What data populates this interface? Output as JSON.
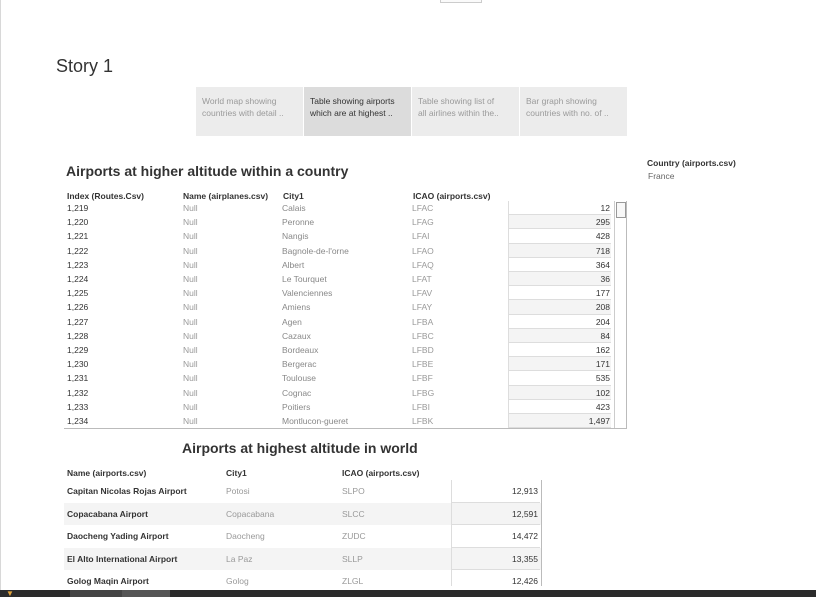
{
  "story": {
    "title": "Story 1"
  },
  "story_points": [
    {
      "line1": "World map showing",
      "line2": "countries with detail ..",
      "active": false
    },
    {
      "line1": "Table showing airports",
      "line2": "which are at highest ..",
      "active": true
    },
    {
      "line1": "Table showing list of",
      "line2": "all airlines within the..",
      "active": false
    },
    {
      "line1": "Bar graph showing",
      "line2": "countries with no. of ..",
      "active": false
    }
  ],
  "filter": {
    "label": "Country (airports.csv)",
    "value": "France"
  },
  "table1": {
    "title": "Airports at higher altitude within a country",
    "headers": [
      "Index (Routes.Csv)",
      "Name (airplanes.csv)",
      "City1",
      "ICAO (airports.csv)"
    ],
    "rows": [
      [
        "1,219",
        "Null",
        "Calais",
        "LFAC",
        "12"
      ],
      [
        "1,220",
        "Null",
        "Peronne",
        "LFAG",
        "295"
      ],
      [
        "1,221",
        "Null",
        "Nangis",
        "LFAI",
        "428"
      ],
      [
        "1,222",
        "Null",
        "Bagnole-de-l'orne",
        "LFAO",
        "718"
      ],
      [
        "1,223",
        "Null",
        "Albert",
        "LFAQ",
        "364"
      ],
      [
        "1,224",
        "Null",
        "Le Tourquet",
        "LFAT",
        "36"
      ],
      [
        "1,225",
        "Null",
        "Valenciennes",
        "LFAV",
        "177"
      ],
      [
        "1,226",
        "Null",
        "Amiens",
        "LFAY",
        "208"
      ],
      [
        "1,227",
        "Null",
        "Agen",
        "LFBA",
        "204"
      ],
      [
        "1,228",
        "Null",
        "Cazaux",
        "LFBC",
        "84"
      ],
      [
        "1,229",
        "Null",
        "Bordeaux",
        "LFBD",
        "162"
      ],
      [
        "1,230",
        "Null",
        "Bergerac",
        "LFBE",
        "171"
      ],
      [
        "1,231",
        "Null",
        "Toulouse",
        "LFBF",
        "535"
      ],
      [
        "1,232",
        "Null",
        "Cognac",
        "LFBG",
        "102"
      ],
      [
        "1,233",
        "Null",
        "Poitiers",
        "LFBI",
        "423"
      ],
      [
        "1,234",
        "Null",
        "Montlucon-gueret",
        "LFBK",
        "1,497"
      ]
    ]
  },
  "table2": {
    "title": "Airports at highest altitude in world",
    "headers": [
      "Name (airports.csv)",
      "City1",
      "ICAO (airports.csv)"
    ],
    "rows": [
      [
        "Capitan Nicolas Rojas Airport",
        "Potosi",
        "SLPO",
        "12,913"
      ],
      [
        "Copacabana Airport",
        "Copacabana",
        "SLCC",
        "12,591"
      ],
      [
        "Daocheng Yading Airport",
        "Daocheng",
        "ZUDC",
        "14,472"
      ],
      [
        "El Alto International Airport",
        "La Paz",
        "SLLP",
        "13,355"
      ],
      [
        "Golog Maqin Airport",
        "Golog",
        "ZLGL",
        "12,426"
      ]
    ]
  },
  "colors": {
    "active_tab": "#dcdcdc",
    "inactive_tab": "#ececec",
    "bottom_bar": "#2b2b2b"
  }
}
